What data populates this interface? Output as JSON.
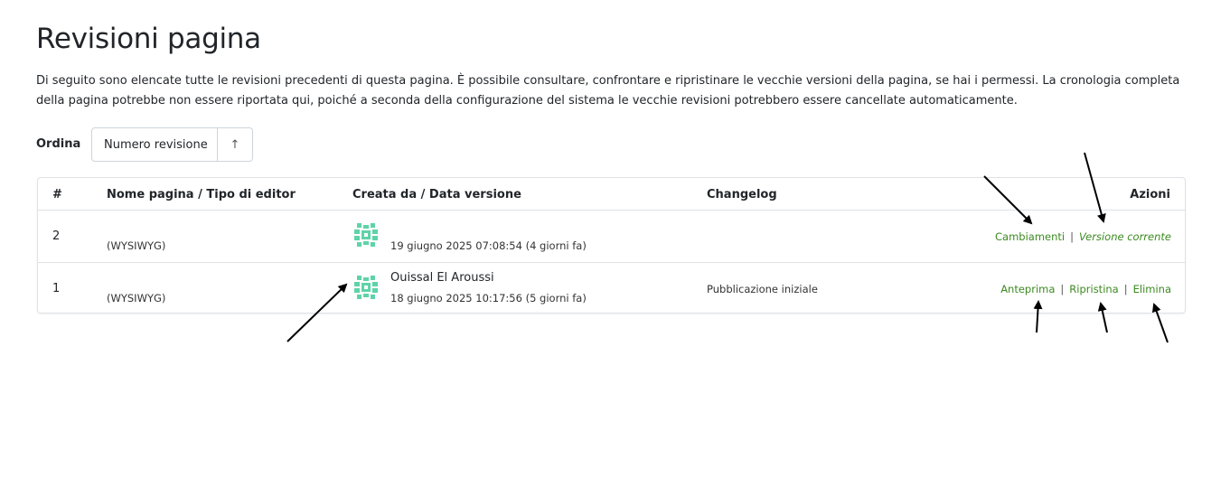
{
  "page": {
    "title": "Revisioni pagina",
    "description": "Di seguito sono elencate tutte le revisioni precedenti di questa pagina. È possibile consultare, confrontare e ripristinare le vecchie versioni della pagina, se hai i permessi. La cronologia completa della pagina potrebbe non essere riportata qui, poiché a seconda della configurazione del sistema le vecchie revisioni potrebbero essere cancellate automaticamente."
  },
  "sort": {
    "label": "Ordina",
    "selected": "Numero revisione",
    "direction_icon": "↑"
  },
  "table": {
    "headers": {
      "num": "#",
      "name": "Nome pagina / Tipo di editor",
      "created": "Creata da / Data versione",
      "changelog": "Changelog",
      "actions": "Azioni"
    },
    "rows": [
      {
        "num": "2",
        "editor": "(WYSIWYG)",
        "author": "",
        "date": "19 giugno 2025 07:08:54 (4 giorni fa)",
        "changelog": "",
        "actions": {
          "changes": "Cambiamenti",
          "separator": "|",
          "current": "Versione corrente"
        }
      },
      {
        "num": "1",
        "editor": "(WYSIWYG)",
        "author": "Ouissal El Aroussi",
        "date": "18 giugno 2025 10:17:56 (5 giorni fa)",
        "changelog": "Pubblicazione iniziale",
        "actions": {
          "preview": "Anteprima",
          "restore": "Ripristina",
          "delete": "Elimina",
          "separator": "|"
        }
      }
    ]
  },
  "colors": {
    "link": "#3b8a1f",
    "avatar": "#5fd3a8"
  }
}
